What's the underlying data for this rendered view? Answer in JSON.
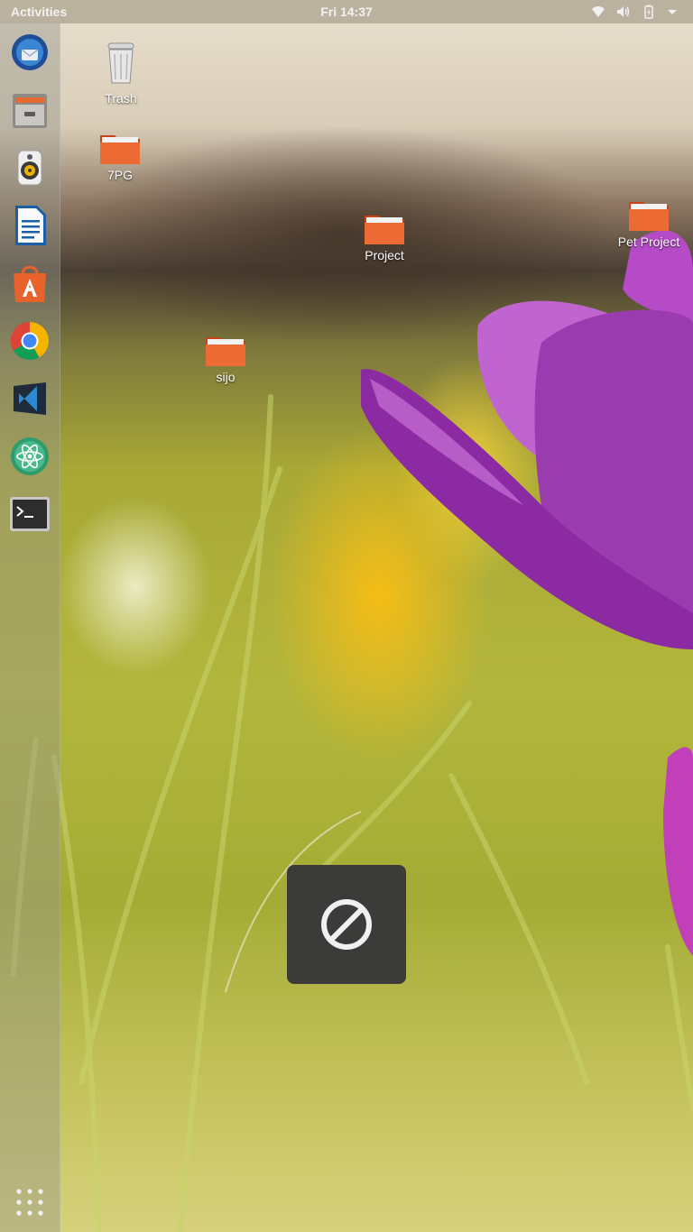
{
  "topbar": {
    "activities_label": "Activities",
    "clock": "Fri 14:37",
    "tray_icons": [
      "wifi-icon",
      "volume-icon",
      "battery-icon",
      "menu-arrow-icon"
    ]
  },
  "dock": {
    "items": [
      {
        "name": "Thunderbird Mail",
        "icon": "thunderbird-icon"
      },
      {
        "name": "Files",
        "icon": "files-icon"
      },
      {
        "name": "Rhythmbox",
        "icon": "rhythmbox-icon"
      },
      {
        "name": "LibreOffice Writer",
        "icon": "writer-icon"
      },
      {
        "name": "Ubuntu Software",
        "icon": "software-icon"
      },
      {
        "name": "Google Chrome",
        "icon": "chrome-icon"
      },
      {
        "name": "Visual Studio Code",
        "icon": "vscode-icon"
      },
      {
        "name": "Atom",
        "icon": "atom-icon"
      },
      {
        "name": "Terminal",
        "icon": "terminal-icon"
      }
    ],
    "apps_button": "show-applications-icon"
  },
  "desktop": {
    "icons": [
      {
        "label": "Trash",
        "icon": "trash-icon"
      },
      {
        "label": "7PG",
        "icon": "folder-icon"
      },
      {
        "label": "Project",
        "icon": "folder-icon"
      },
      {
        "label": "Pet Project",
        "icon": "folder-icon"
      },
      {
        "label": "sijo",
        "icon": "folder-icon"
      }
    ]
  },
  "osd": {
    "icon": "disabled-icon"
  },
  "colors": {
    "folder_orange": "#e95420",
    "topbar_text": "#f2f2f2",
    "osd_bg": "#3b3b3a"
  }
}
